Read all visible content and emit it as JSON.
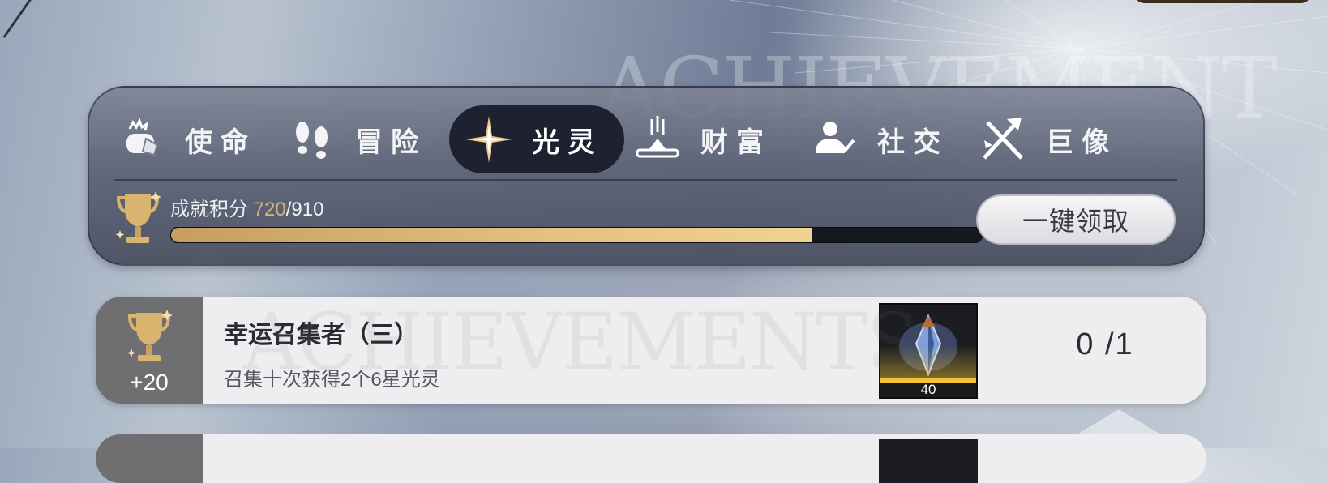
{
  "background": {
    "watermark_top": "ACHIEVEMENT",
    "watermark_card": "ACHIEVEMENTS"
  },
  "colors": {
    "gold": "#d6b277",
    "progress_fill": "#e4c27f",
    "active_tab": "#1e2230",
    "card_left": "#6f6f72"
  },
  "tabs": [
    {
      "label": "使命",
      "icon": "fist-icon",
      "active": false
    },
    {
      "label": "冒险",
      "icon": "footprints-icon",
      "active": false
    },
    {
      "label": "光灵",
      "icon": "star-sparkle-icon",
      "active": true
    },
    {
      "label": "财富",
      "icon": "treasure-icon",
      "active": false
    },
    {
      "label": "社交",
      "icon": "user-check-icon",
      "active": false
    },
    {
      "label": "巨像",
      "icon": "crossed-swords-icon",
      "active": false
    }
  ],
  "score": {
    "label": "成就积分",
    "current": "720",
    "total": "/910",
    "progress_fraction": 0.791
  },
  "claim_all_button": "一键领取",
  "achievements": [
    {
      "points": "+20",
      "title": "幸运召集者（三）",
      "description": "召集十次获得2个6星光灵",
      "reward_qty": "40",
      "progress": "0 /1"
    }
  ]
}
